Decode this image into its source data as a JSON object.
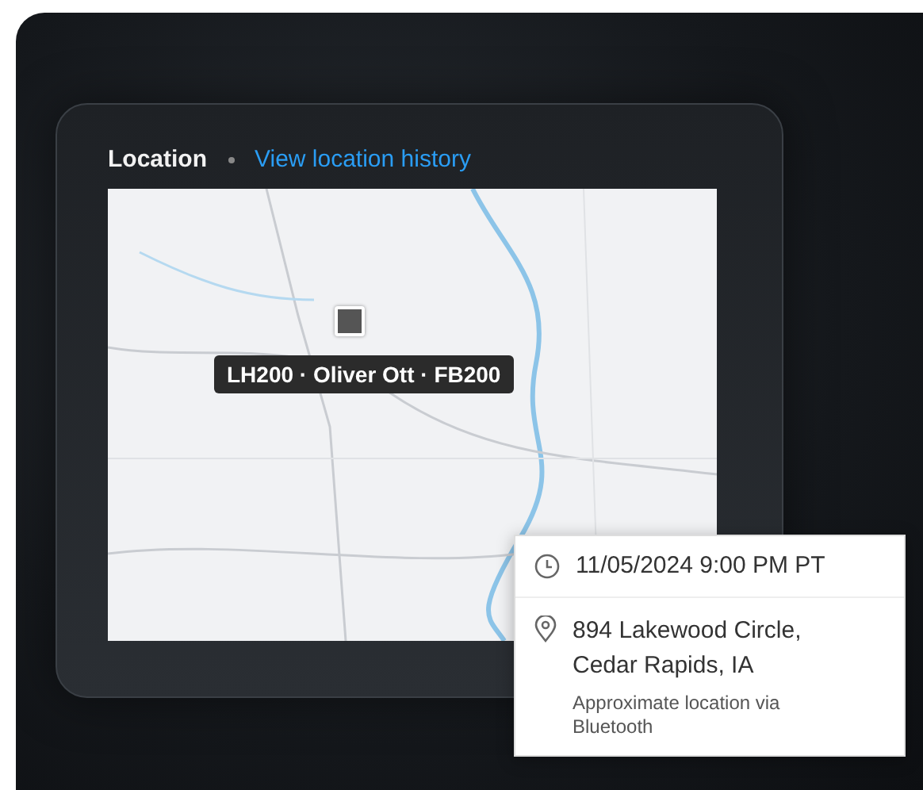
{
  "card": {
    "title": "Location",
    "link": "View location history"
  },
  "map": {
    "label": "LH200 · Oliver Ott · FB200"
  },
  "popup": {
    "time": "11/05/2024 9:00 PM PT",
    "address": "894 Lakewood Circle, Cedar Rapids, IA",
    "note": "Approximate location via Bluetooth"
  }
}
